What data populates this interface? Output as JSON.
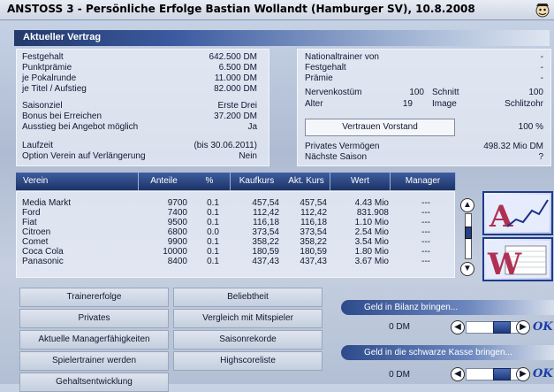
{
  "window": {
    "title": "ANSTOSS 3 - Persönliche Erfolge Bastian Wollandt (Hamburger SV), 10.8.2008"
  },
  "contract": {
    "header": "Aktueller Vertrag",
    "left": [
      {
        "label": "Festgehalt",
        "value": "642.500 DM"
      },
      {
        "label": "Punktprämie",
        "value": "6.500 DM"
      },
      {
        "label": "je Pokalrunde",
        "value": "11.000 DM"
      },
      {
        "label": "je Titel / Aufstieg",
        "value": "82.000 DM"
      },
      {
        "label": "Saisonziel",
        "value": "Erste Drei"
      },
      {
        "label": "Bonus bei Erreichen",
        "value": "37.200 DM"
      },
      {
        "label": "Ausstieg bei Angebot möglich",
        "value": "Ja"
      },
      {
        "label": "Laufzeit",
        "value": "(bis 30.06.2011)"
      },
      {
        "label": "Option Verein auf Verlängerung",
        "value": "Nein"
      }
    ],
    "right": {
      "nationaltrainer_label": "Nationaltrainer von",
      "nationaltrainer_value": "-",
      "festgehalt_label": "Festgehalt",
      "festgehalt_value": "-",
      "praemie_label": "Prämie",
      "praemie_value": "-",
      "nerven_label": "Nervenkostüm",
      "nerven_value": "100",
      "schnitt_label": "Schnitt",
      "schnitt_value": "100",
      "alter_label": "Alter",
      "alter_value": "19",
      "image_label": "Image",
      "image_value": "Schlitzohr",
      "vertrauen_button": "Vertrauen Vorstand",
      "vertrauen_value": "100 %",
      "vermoegen_label": "Privates Vermögen",
      "vermoegen_value": "498.32 Mio DM",
      "saison_label": "Nächste Saison",
      "saison_value": "?"
    }
  },
  "stocks": {
    "headers": [
      "Verein",
      "Anteile",
      "%",
      "Kaufkurs",
      "Akt. Kurs",
      "Wert",
      "Manager"
    ],
    "rows": [
      [
        "Media Markt",
        "9700",
        "0.1",
        "457,54",
        "457,54",
        "4.43 Mio",
        "---"
      ],
      [
        "Ford",
        "7400",
        "0.1",
        "112,42",
        "112,42",
        "831.908",
        "---"
      ],
      [
        "Fiat",
        "9500",
        "0.1",
        "116,18",
        "116,18",
        "1.10 Mio",
        "---"
      ],
      [
        "Citroen",
        "6800",
        "0.0",
        "373,54",
        "373,54",
        "2.54 Mio",
        "---"
      ],
      [
        "Comet",
        "9900",
        "0.1",
        "358,22",
        "358,22",
        "3.54 Mio",
        "---"
      ],
      [
        "Coca Cola",
        "10000",
        "0.1",
        "180,59",
        "180,59",
        "1.80 Mio",
        "---"
      ],
      [
        "Panasonic",
        "8400",
        "0.1",
        "437,43",
        "437,43",
        "3.67 Mio",
        "---"
      ]
    ]
  },
  "buttons": {
    "left": [
      "Trainererfolge",
      "Privates",
      "Aktuelle Managerfähigkeiten",
      "Spielertrainer werden",
      "Gehaltsentwicklung"
    ],
    "right": [
      "Beliebtheit",
      "Vergleich mit Mitspieler",
      "Saisonrekorde",
      "Highscoreliste"
    ]
  },
  "geld": {
    "bilanz_label": "Geld in Bilanz bringen...",
    "bilanz_value": "0 DM",
    "schwarz_label": "Geld in die schwarze Kasse bringen...",
    "schwarz_value": "0 DM",
    "ok_label": "OK"
  },
  "nav": {
    "up_arrow": "▲",
    "down_arrow": "▼",
    "left_arrow": "◀",
    "right_arrow": "▶"
  },
  "colors": {
    "accent": "#1d3366",
    "ok": "#1d3ea8"
  }
}
